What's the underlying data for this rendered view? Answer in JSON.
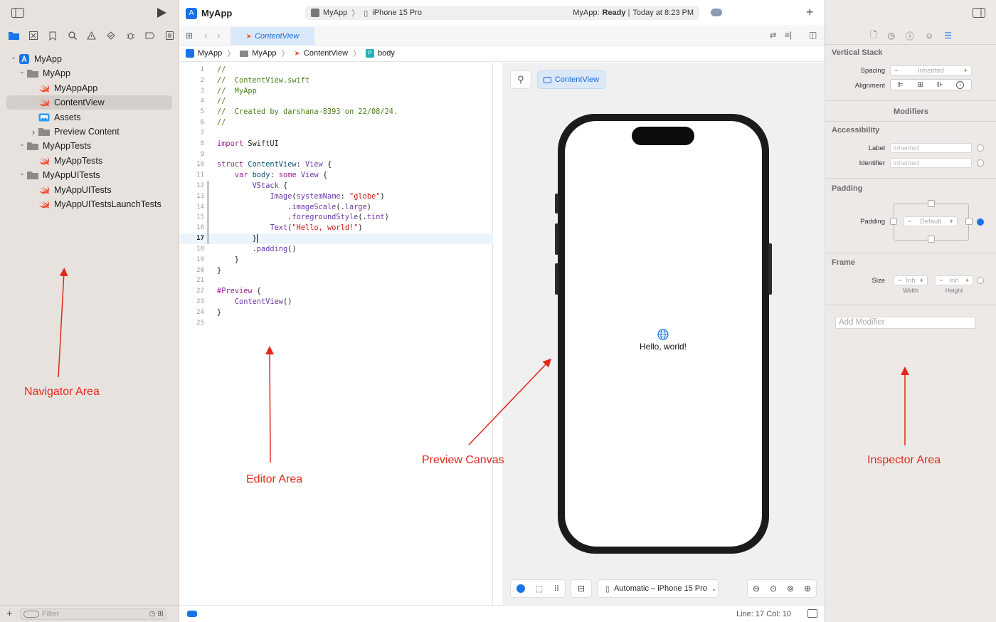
{
  "window": {
    "project": "MyApp",
    "scheme": "MyApp",
    "device": "iPhone 15 Pro",
    "status_prefix": "MyApp:",
    "status_state": "Ready",
    "status_time": "Today at 8:23 PM"
  },
  "navigator": {
    "tree": [
      {
        "label": "MyApp",
        "level": 0,
        "chevron": "down",
        "icon": "project-icon"
      },
      {
        "label": "MyApp",
        "level": 1,
        "chevron": "down",
        "icon": "folder-icon"
      },
      {
        "label": "MyAppApp",
        "level": 2,
        "chevron": "",
        "icon": "swift-file-icon"
      },
      {
        "label": "ContentView",
        "level": 2,
        "chevron": "",
        "icon": "swift-file-icon",
        "selected": true
      },
      {
        "label": "Assets",
        "level": 2,
        "chevron": "",
        "icon": "asset-catalog-icon"
      },
      {
        "label": "Preview Content",
        "level": 2,
        "chevron": "right",
        "icon": "folder-icon"
      },
      {
        "label": "MyAppTests",
        "level": 1,
        "chevron": "down",
        "icon": "folder-icon"
      },
      {
        "label": "MyAppTests",
        "level": 2,
        "chevron": "",
        "icon": "swift-file-icon"
      },
      {
        "label": "MyAppUITests",
        "level": 1,
        "chevron": "down",
        "icon": "folder-icon"
      },
      {
        "label": "MyAppUITests",
        "level": 2,
        "chevron": "",
        "icon": "swift-file-icon"
      },
      {
        "label": "MyAppUITestsLaunchTests",
        "level": 2,
        "chevron": "",
        "icon": "swift-file-icon"
      }
    ],
    "filter_placeholder": "Filter"
  },
  "editor": {
    "tab_label": "ContentView",
    "breadcrumb": [
      "MyApp",
      "MyApp",
      "ContentView",
      "body"
    ],
    "current_line": 17,
    "lines": [
      [
        [
          "cm",
          "//"
        ]
      ],
      [
        [
          "cm",
          "//  ContentView.swift"
        ]
      ],
      [
        [
          "cm",
          "//  MyApp"
        ]
      ],
      [
        [
          "cm",
          "//"
        ]
      ],
      [
        [
          "cm",
          "//  Created by darshana-8393 on 22/08/24."
        ]
      ],
      [
        [
          "cm",
          "//"
        ]
      ],
      [],
      [
        [
          "kw",
          "import"
        ],
        [
          "pl",
          " SwiftUI"
        ]
      ],
      [],
      [
        [
          "kw",
          "struct"
        ],
        [
          "pl",
          " "
        ],
        [
          "ty",
          "ContentView"
        ],
        [
          "pl",
          ": "
        ],
        [
          "pr",
          "View"
        ],
        [
          "pl",
          " {"
        ]
      ],
      [
        [
          "pl",
          "    "
        ],
        [
          "kw",
          "var"
        ],
        [
          "pl",
          " "
        ],
        [
          "ty",
          "body"
        ],
        [
          "pl",
          ": "
        ],
        [
          "kw",
          "some"
        ],
        [
          "pl",
          " "
        ],
        [
          "pr",
          "View"
        ],
        [
          "pl",
          " {"
        ]
      ],
      [
        [
          "pl",
          "        "
        ],
        [
          "pr",
          "VStack"
        ],
        [
          "pl",
          " {"
        ]
      ],
      [
        [
          "pl",
          "            "
        ],
        [
          "pr",
          "Image"
        ],
        [
          "pl",
          "("
        ],
        [
          "pr",
          "systemName"
        ],
        [
          "pl",
          ": "
        ],
        [
          "st",
          "\"globe\""
        ],
        [
          "pl",
          ")"
        ]
      ],
      [
        [
          "pl",
          "                ."
        ],
        [
          "pr",
          "imageScale"
        ],
        [
          "pl",
          "(."
        ],
        [
          "pr",
          "large"
        ],
        [
          "pl",
          ")"
        ]
      ],
      [
        [
          "pl",
          "                ."
        ],
        [
          "pr",
          "foregroundStyle"
        ],
        [
          "pl",
          "(."
        ],
        [
          "pr",
          "tint"
        ],
        [
          "pl",
          ")"
        ]
      ],
      [
        [
          "pl",
          "            "
        ],
        [
          "pr",
          "Text"
        ],
        [
          "pl",
          "("
        ],
        [
          "st",
          "\"Hello, world!\""
        ],
        [
          "pl",
          ")"
        ]
      ],
      [
        [
          "pl",
          "        }"
        ]
      ],
      [
        [
          "pl",
          "        ."
        ],
        [
          "pr",
          "padding"
        ],
        [
          "pl",
          "()"
        ]
      ],
      [
        [
          "pl",
          "    }"
        ]
      ],
      [
        [
          "pl",
          "}"
        ]
      ],
      [],
      [
        [
          "kw",
          "#Preview"
        ],
        [
          "pl",
          " {"
        ]
      ],
      [
        [
          "pl",
          "    "
        ],
        [
          "pr",
          "ContentView"
        ],
        [
          "pl",
          "()"
        ]
      ],
      [
        [
          "pl",
          "}"
        ]
      ],
      []
    ],
    "status": "Line: 17  Col: 10"
  },
  "canvas": {
    "preview_tab": "ContentView",
    "hello_text": "Hello, world!",
    "device_menu": "Automatic – iPhone 15 Pro"
  },
  "inspector": {
    "section_vstack": "Vertical Stack",
    "spacing_label": "Spacing",
    "spacing_value": "Inherited",
    "alignment_label": "Alignment",
    "modifiers_header": "Modifiers",
    "accessibility_header": "Accessibility",
    "label_label": "Label",
    "label_value": "Inherited",
    "identifier_label": "Identifier",
    "identifier_value": "Inherited",
    "padding_header": "Padding",
    "padding_label": "Padding",
    "padding_value": "Default",
    "frame_header": "Frame",
    "size_label": "Size",
    "width_value": "Inh",
    "height_value": "Inh",
    "width_caption": "Width",
    "height_caption": "Height",
    "add_modifier_placeholder": "Add Modifier"
  },
  "annotations": {
    "navigator": "Navigator Area",
    "editor": "Editor Area",
    "canvas": "Preview Canvas",
    "inspector": "Inspector Area"
  },
  "colors": {
    "accent": "#1a73e8",
    "annotation": "#e3271b",
    "swift": "#f05138"
  }
}
